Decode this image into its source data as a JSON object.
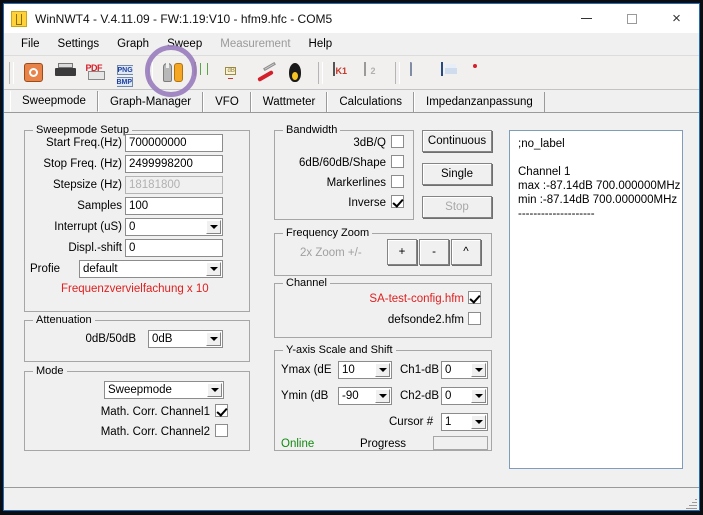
{
  "window": {
    "title": "WinNWT4 - V.4.11.09 - FW:1.19:V10 - hfm9.hfc - COM5",
    "app_icon": "winnwt-icon",
    "minimize_label": "",
    "maximize_label": "",
    "close_label": "×"
  },
  "menubar": {
    "items": [
      {
        "label": "File",
        "disabled": false
      },
      {
        "label": "Settings",
        "disabled": false
      },
      {
        "label": "Graph",
        "disabled": false
      },
      {
        "label": "Sweep",
        "disabled": false
      },
      {
        "label": "Measurement",
        "disabled": true
      },
      {
        "label": "Help",
        "disabled": false
      }
    ]
  },
  "toolbar": {
    "icons": [
      "power-icon",
      "printer-icon",
      "pdf-export-icon",
      "png-bmp-export-icon",
      "settings-tools-icon",
      "graph-view-icon",
      "db-view-icon",
      "calibration-knife-icon",
      "linux-tux-icon",
      "k1-memory-icon",
      "k2-memory-icon",
      "open-folder-icon",
      "save-disk-icon",
      "network-icon"
    ],
    "highlight": "settings-tools-icon"
  },
  "tabs": [
    {
      "label": "Sweepmode",
      "active": true
    },
    {
      "label": "Graph-Manager",
      "active": false
    },
    {
      "label": "VFO",
      "active": false
    },
    {
      "label": "Wattmeter",
      "active": false
    },
    {
      "label": "Calculations",
      "active": false
    },
    {
      "label": "Impedanzanpassung",
      "active": false
    }
  ],
  "sweepmode_setup": {
    "title": "Sweepmode Setup",
    "start_freq_label": "Start Freq.(Hz)",
    "start_freq_value": "700000000",
    "stop_freq_label": "Stop Freq. (Hz)",
    "stop_freq_value": "2499998200",
    "stepsize_label": "Stepsize (Hz)",
    "stepsize_value": "18181800",
    "samples_label": "Samples",
    "samples_value": "100",
    "interrupt_label": "Interrupt (uS)",
    "interrupt_value": "0",
    "displ_shift_label": "Displ.-shift",
    "displ_shift_value": "0",
    "profile_label": "Profie",
    "profile_value": "default",
    "note": "Frequenzvervielfachung x 10",
    "note_color": "#e02020"
  },
  "attenuation": {
    "title": "Attenuation",
    "label": "0dB/50dB",
    "value": "0dB"
  },
  "mode": {
    "title": "Mode",
    "value": "Sweepmode",
    "math_corr_ch1_label": "Math. Corr. Channel1",
    "math_corr_ch1_checked": true,
    "math_corr_ch2_label": "Math. Corr. Channel2",
    "math_corr_ch2_checked": false
  },
  "bandwidth": {
    "title": "Bandwidth",
    "items": [
      {
        "label": "3dB/Q",
        "checked": false
      },
      {
        "label": "6dB/60dB/Shape",
        "checked": false
      },
      {
        "label": "Markerlines",
        "checked": false
      },
      {
        "label": "Inverse",
        "checked": true
      }
    ]
  },
  "run_buttons": [
    {
      "label": "Continuous",
      "disabled": false
    },
    {
      "label": "Single",
      "disabled": false
    },
    {
      "label": "Stop",
      "disabled": true
    }
  ],
  "frequency_zoom": {
    "title": "Frequency Zoom",
    "label": "2x Zoom +/-",
    "buttons": [
      "+",
      "-",
      "^"
    ]
  },
  "channel": {
    "title": "Channel",
    "items": [
      {
        "label": "SA-test-config.hfm",
        "checked": true,
        "color": "#e02020"
      },
      {
        "label": "defsonde2.hfm",
        "checked": false,
        "color": "#000000"
      }
    ]
  },
  "yaxis": {
    "title": "Y-axis Scale and Shift",
    "ymax_label": "Ymax (dE",
    "ymax_value": "10",
    "ymin_label": "Ymin (dB",
    "ymin_value": "-90",
    "ch1_label": "Ch1-dB",
    "ch1_value": "0",
    "ch2_label": "Ch2-dB",
    "ch2_value": "0",
    "cursor_label": "Cursor #",
    "cursor_value": "1",
    "status": "Online",
    "status_color": "#118a11",
    "progress_label": "Progress",
    "progress_value": ""
  },
  "info_panel": {
    "text": ";no_label\n\nChannel 1\nmax :-87.14dB 700.000000MHz\nmin :-87.14dB 700.000000MHz\n--------------------"
  },
  "statusbar": {
    "text": ""
  }
}
